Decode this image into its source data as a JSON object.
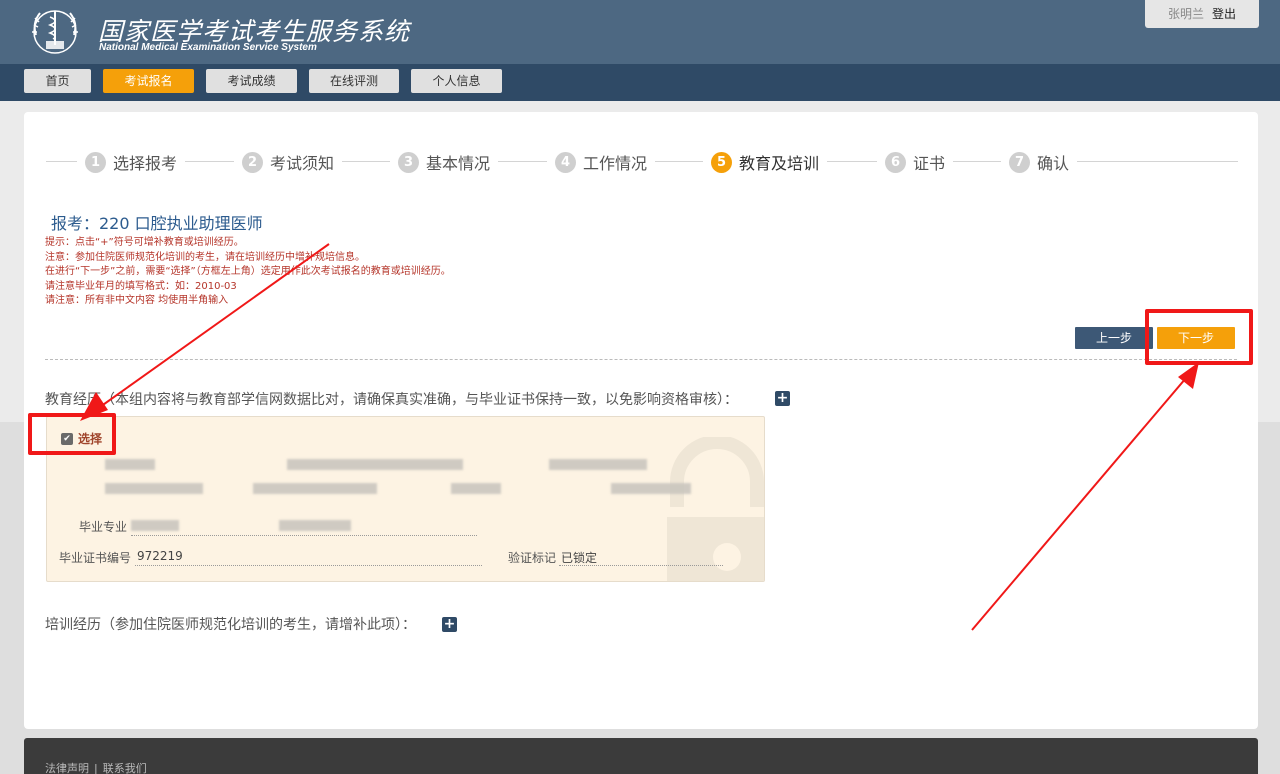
{
  "header": {
    "title": "国家医学考试考生服务系统",
    "subtitle": "National Medical Examination Service System",
    "user_name": "张明兰",
    "logout_label": "登出"
  },
  "nav": {
    "tabs": [
      {
        "label": "首页"
      },
      {
        "label": "考试报名",
        "active": true
      },
      {
        "label": "考试成绩"
      },
      {
        "label": "在线评测"
      },
      {
        "label": "个人信息"
      }
    ]
  },
  "steps": [
    {
      "num": "1",
      "label": "选择报考"
    },
    {
      "num": "2",
      "label": "考试须知"
    },
    {
      "num": "3",
      "label": "基本情况"
    },
    {
      "num": "4",
      "label": "工作情况"
    },
    {
      "num": "5",
      "label": "教育及培训",
      "active": true
    },
    {
      "num": "6",
      "label": "证书"
    },
    {
      "num": "7",
      "label": "确认"
    }
  ],
  "exam": {
    "title": "报考：220 口腔执业助理医师"
  },
  "notes": [
    "提示：点击“+”符号可增补教育或培训经历。",
    "注意：参加住院医师规范化培训的考生，请在培训经历中增补规培信息。",
    "在进行“下一步”之前，需要“选择”（方框左上角）选定用作此次考试报名的教育或培训经历。",
    "请注意毕业年月的填写格式：如：2010-03",
    "请注意：所有非中文内容 均使用半角输入"
  ],
  "buttons": {
    "prev": "上一步",
    "next": "下一步"
  },
  "education": {
    "section_label": "教育经历（本组内容将与教育部学信网数据比对，请确保真实准确，与毕业证书保持一致，以免影响资格审核）：",
    "select_label": "选择",
    "select_checked": true,
    "major_label": "毕业专业",
    "cert_label": "毕业证书编号",
    "cert_value": "972219",
    "verify_label": "验证标记",
    "verify_value": "已锁定"
  },
  "training": {
    "section_label": "培训经历（参加住院医师规范化培训的考生，请增补此项）："
  },
  "footer": {
    "legal": "法律声明",
    "separator": "|",
    "contact": "联系我们"
  },
  "colors": {
    "header_bg": "#4d6882",
    "nav_bg": "#2f4a66",
    "accent": "#f5a00a",
    "annotation_red": "#f01818",
    "note_red": "#b5352a"
  }
}
